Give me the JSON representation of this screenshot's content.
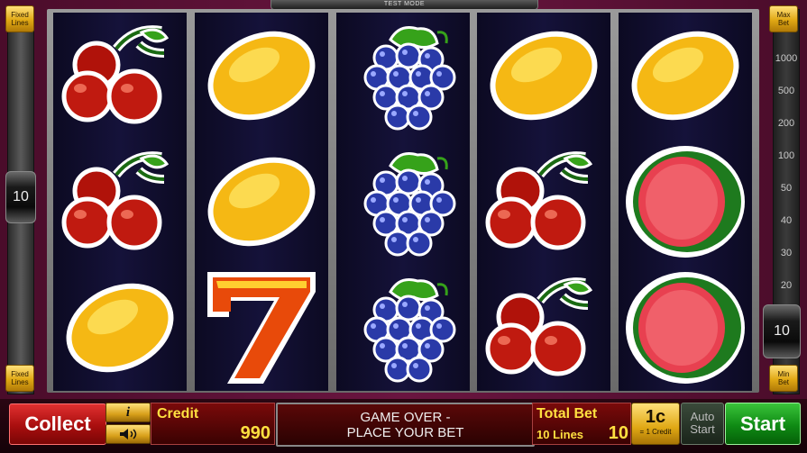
{
  "header": {
    "mode_label": "TEST MODE"
  },
  "left_panel": {
    "fixed_lines_top": "Fixed\nLines",
    "fixed_lines_bottom": "Fixed\nLines",
    "lines_indicator": "10"
  },
  "right_panel": {
    "max_bet": "Max\nBet",
    "min_bet": "Min\nBet",
    "bet_scale": [
      "1000",
      "500",
      "200",
      "100",
      "50",
      "40",
      "30",
      "20"
    ],
    "current_bet_indicator": "10"
  },
  "reels": [
    [
      "cherry",
      "cherry",
      "lemon"
    ],
    [
      "lemon",
      "lemon",
      "seven"
    ],
    [
      "grapes",
      "grapes",
      "grapes"
    ],
    [
      "lemon",
      "cherry",
      "cherry"
    ],
    [
      "lemon",
      "watermelon",
      "watermelon"
    ]
  ],
  "bottom_bar": {
    "collect_label": "Collect",
    "info_icon_label": "i",
    "credit_label": "Credit",
    "credit_value": "990",
    "message_line1": "GAME OVER -",
    "message_line2": "PLACE YOUR BET",
    "total_bet_label": "Total Bet",
    "lines_text": "10 Lines",
    "total_bet_value": "10",
    "denomination": "1c",
    "denomination_sub": "= 1 Credit",
    "auto_start_line1": "Auto",
    "auto_start_line2": "Start",
    "start_label": "Start"
  },
  "colors": {
    "background": "#5a1035",
    "reel_bg": "#15123a",
    "accent_gold": "#e0a814",
    "start_green": "#0f8a14",
    "collect_red": "#a80e0e",
    "label_yellow": "#ffe040"
  }
}
